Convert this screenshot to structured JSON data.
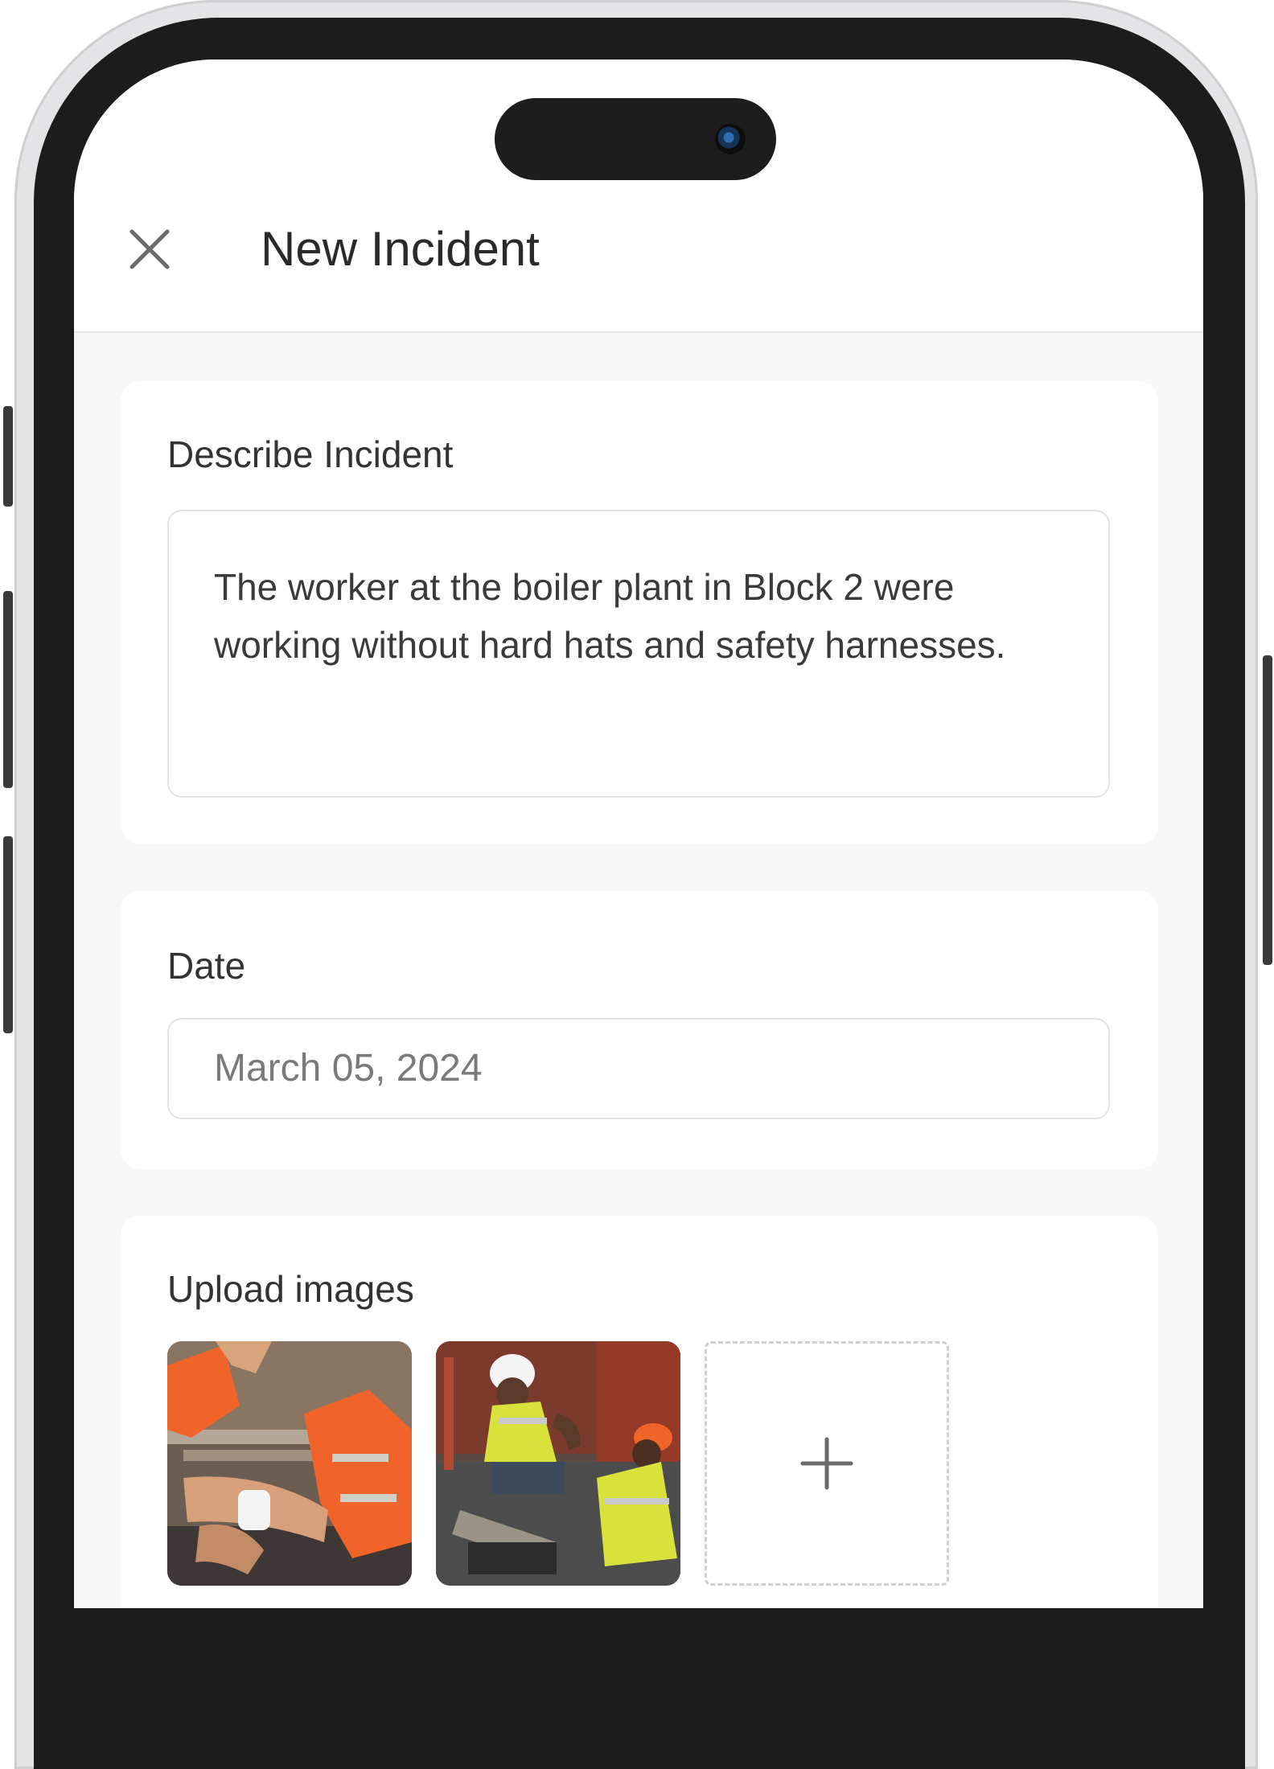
{
  "header": {
    "title": "New Incident",
    "close_icon": "close-icon"
  },
  "describe": {
    "label": "Describe Incident",
    "value": "The worker at the boiler plant in Block 2 were working without hard hats and safety harnesses."
  },
  "date": {
    "label": "Date",
    "value": "March 05, 2024"
  },
  "upload": {
    "label": "Upload images",
    "add_icon": "plus-icon",
    "images": [
      {
        "name": "worker-bandaging-arm-photo"
      },
      {
        "name": "worker-helping-fallen-worker-photo"
      }
    ]
  },
  "colors": {
    "screen_bg": "#f7f7f7",
    "card_bg": "#ffffff",
    "frame": "#1c1c1c",
    "vest_orange": "#f0642a",
    "vest_yellow": "#d8e23a"
  }
}
